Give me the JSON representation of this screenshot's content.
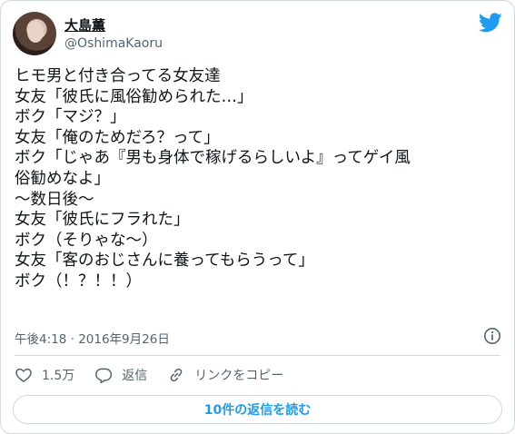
{
  "author": {
    "display_name": "大島薫",
    "username": "@OshimaKaoru",
    "avatar_icon": "avatar-photo"
  },
  "brand": {
    "icon": "twitter-bird-icon",
    "color": "#1d9bf0"
  },
  "tweet": {
    "lines": [
      "ヒモ男と付き合ってる女友達",
      "女友「彼氏に風俗勧められた…」",
      "ボク「マジ？」",
      "女友「俺のためだろ？って」",
      "ボク「じゃあ『男も身体で稼げるらしいよ』ってゲイ風",
      "俗勧めなよ」",
      "〜数日後〜",
      "女友「彼氏にフラれた」",
      "ボク（そりゃな〜）",
      "女友「客のおじさんに養ってもらうって」",
      "ボク（！？！！）"
    ],
    "timestamp": "午後4:18 · 2016年9月26日"
  },
  "actions": {
    "like_count": "1.5万",
    "reply_label": "返信",
    "copy_link_label": "リンクをコピー"
  },
  "replies_button": {
    "label": "10件の返信を読む"
  },
  "colors": {
    "text_primary": "#0f1419",
    "text_secondary": "#536471",
    "border": "#cfd9de",
    "accent": "#1d9bf0"
  }
}
